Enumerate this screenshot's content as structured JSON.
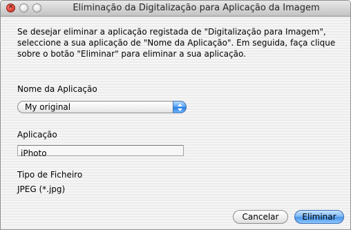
{
  "window": {
    "title": "Eliminação da Digitalização para Aplicação da Imagem"
  },
  "instructions": "Se desejar eliminar a aplicação registada de \"Digitalização para Imagem\",\nseleccione a sua aplicação de \"Nome da Aplicação\". Em seguida, faça clique\nsobre o botão \"Eliminar\" para eliminar a sua aplicação.",
  "app_name": {
    "label": "Nome da Aplicação",
    "selected": "My original"
  },
  "application": {
    "label": "Aplicação",
    "value": "iPhoto"
  },
  "file_type": {
    "label": "Tipo de Ficheiro",
    "value": "JPEG (*.jpg)"
  },
  "buttons": {
    "cancel": "Cancelar",
    "eliminate": "Eliminar"
  },
  "icons": {
    "close": "close-icon",
    "minimize": "minimize-icon",
    "zoom": "zoom-icon",
    "popup_arrows": "up-down-arrows-icon"
  }
}
